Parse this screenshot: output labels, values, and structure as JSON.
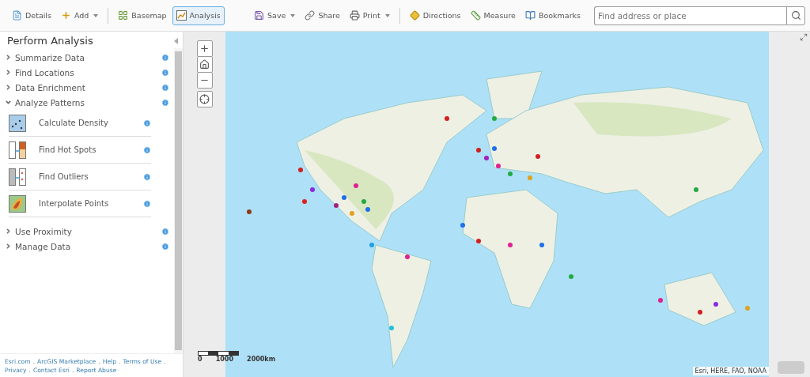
{
  "toolbar": {
    "left": [
      {
        "label": "Details",
        "kind": "plain",
        "selected": false
      },
      {
        "label": "Add",
        "kind": "dropdown",
        "selected": false
      },
      {
        "label": "Basemap",
        "kind": "plain",
        "selected": false
      },
      {
        "label": "Analysis",
        "kind": "plain",
        "selected": true
      }
    ],
    "right": [
      {
        "label": "Save",
        "kind": "dropdown"
      },
      {
        "label": "Share",
        "kind": "plain"
      },
      {
        "label": "Print",
        "kind": "dropdown"
      },
      {
        "label": "Directions",
        "kind": "plain"
      },
      {
        "label": "Measure",
        "kind": "plain"
      },
      {
        "label": "Bookmarks",
        "kind": "plain"
      }
    ],
    "search": {
      "placeholder": "Find address or place"
    }
  },
  "sidebar": {
    "title": "Perform Analysis",
    "categories": [
      {
        "label": "Summarize Data",
        "expanded": false
      },
      {
        "label": "Find Locations",
        "expanded": false
      },
      {
        "label": "Data Enrichment",
        "expanded": false
      },
      {
        "label": "Analyze Patterns",
        "expanded": true,
        "children": [
          {
            "label": "Calculate Density"
          },
          {
            "label": "Find Hot Spots"
          },
          {
            "label": "Find Outliers"
          },
          {
            "label": "Interpolate Points"
          }
        ]
      },
      {
        "label": "Use Proximity",
        "expanded": false
      },
      {
        "label": "Manage Data",
        "expanded": false
      }
    ],
    "footer_links": [
      {
        "label": "Esri.com",
        "separator": "."
      },
      {
        "label": "ArcGIS Marketplace",
        "separator": "."
      },
      {
        "label": "Help",
        "separator": "."
      },
      {
        "label": "Terms of Use",
        "separator": "."
      },
      {
        "label": "Privacy",
        "separator": "."
      },
      {
        "label": "Contact Esri",
        "separator": "."
      },
      {
        "label": "Report Abuse"
      }
    ]
  },
  "map": {
    "scale_labels": [
      "0",
      "1000",
      "2000km"
    ],
    "attribution": "Esri, HERE, FAO, NOAA"
  }
}
